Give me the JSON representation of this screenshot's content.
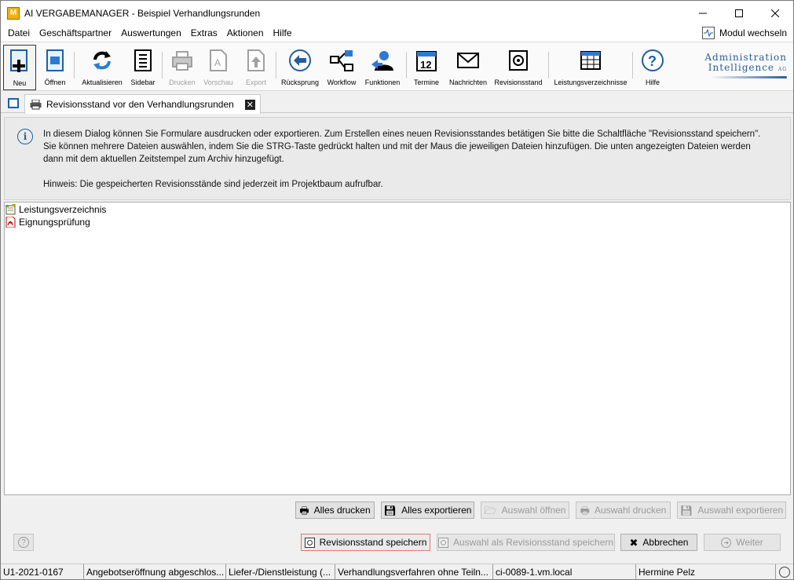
{
  "window": {
    "title": "AI VERGABEMANAGER - Beispiel Verhandlungsrunden",
    "app_icon_letter": "M"
  },
  "menu": {
    "items": [
      "Datei",
      "Geschäftspartner",
      "Auswertungen",
      "Extras",
      "Aktionen",
      "Hilfe"
    ],
    "modul_wechseln": "Modul wechseln"
  },
  "toolbar": {
    "neu": "Neu",
    "oeffnen": "Öffnen",
    "aktualisieren": "Aktualisieren",
    "sidebar": "Sidebar",
    "drucken": "Drucken",
    "vorschau": "Vorschau",
    "export": "Export",
    "ruecksprung": "Rücksprung",
    "workflow": "Workflow",
    "funktionen": "Funktionen",
    "termine": "Termine",
    "termine_day": "12",
    "nachrichten": "Nachrichten",
    "revisionsstand": "Revisionsstand",
    "leistungsverzeichnisse": "Leistungsverzeichnisse",
    "hilfe": "Hilfe"
  },
  "logo": {
    "line1": "Administration",
    "line2": "Intelligence",
    "suffix": "AG"
  },
  "tab": {
    "label": "Revisionsstand vor den Verhandlungsrunden"
  },
  "info": {
    "line1": "In diesem Dialog können Sie Formulare ausdrucken oder exportieren. Zum Erstellen eines neuen Revisionsstandes betätigen Sie bitte die Schaltfläche \"Revisionsstand speichern\".",
    "line2": "Sie können mehrere Dateien auswählen, indem Sie die STRG-Taste gedrückt halten und mit der Maus die jeweiligen Dateien hinzufügen. Die unten angezeigten Dateien werden",
    "line3": "dann mit dem aktuellen Zeitstempel zum Archiv hinzugefügt.",
    "hint": "Hinweis: Die gespeicherten Revisionsstände sind jederzeit im Projektbaum aufrufbar."
  },
  "files": [
    {
      "name": "Leistungsverzeichnis",
      "icon": "notepad-icon"
    },
    {
      "name": "Eignungsprüfung",
      "icon": "pdf-icon"
    }
  ],
  "buttons": {
    "alles_drucken": "Alles drucken",
    "alles_exportieren": "Alles exportieren",
    "auswahl_oeffnen": "Auswahl öffnen",
    "auswahl_drucken": "Auswahl drucken",
    "auswahl_exportieren": "Auswahl exportieren",
    "revisionsstand_speichern": "Revisionsstand speichern",
    "auswahl_als_revisionsstand": "Auswahl als Revisionsstand speichern",
    "abbrechen": "Abbrechen",
    "weiter": "Weiter",
    "help_symbol": "?"
  },
  "statusbar": {
    "id": "U1-2021-0167",
    "phase": "Angebotseröffnung abgeschlos...",
    "type": "Liefer-/Dienstleistung (...",
    "procedure": "Verhandlungsverfahren ohne Teiln...",
    "host": "ci-0089-1.vm.local",
    "user": "Hermine Pelz"
  },
  "colors": {
    "accent_blue": "#1f5fa0",
    "primary_button_border": "#e07878"
  }
}
